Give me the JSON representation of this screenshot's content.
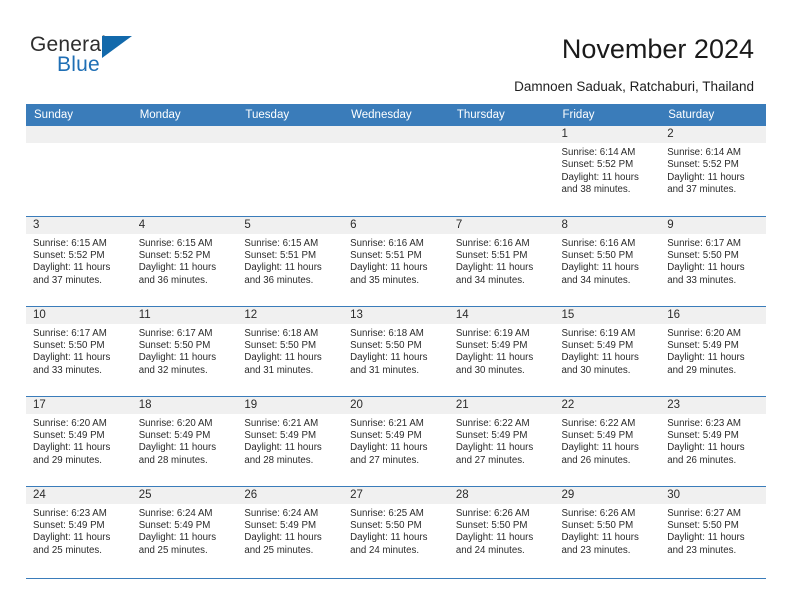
{
  "brand": {
    "name_part1": "General",
    "name_part2": "Blue",
    "triangle_color": "#1269ab",
    "blue_text_color": "#1f6fb5"
  },
  "header": {
    "title": "November 2024",
    "subtitle": "Damnoen Saduak, Ratchaburi, Thailand",
    "accent_color": "#3a7cba",
    "band_color": "#f0f0f0"
  },
  "weekday_headers": [
    "Sunday",
    "Monday",
    "Tuesday",
    "Wednesday",
    "Thursday",
    "Friday",
    "Saturday"
  ],
  "labels": {
    "sunrise": "Sunrise:",
    "sunset": "Sunset:",
    "daylight": "Daylight:"
  },
  "weeks": [
    [
      {
        "empty": true
      },
      {
        "empty": true
      },
      {
        "empty": true
      },
      {
        "empty": true
      },
      {
        "empty": true
      },
      {
        "day": "1",
        "sunrise": "Sunrise: 6:14 AM",
        "sunset": "Sunset: 5:52 PM",
        "daylight_l1": "Daylight: 11 hours",
        "daylight_l2": "and 38 minutes."
      },
      {
        "day": "2",
        "sunrise": "Sunrise: 6:14 AM",
        "sunset": "Sunset: 5:52 PM",
        "daylight_l1": "Daylight: 11 hours",
        "daylight_l2": "and 37 minutes."
      }
    ],
    [
      {
        "day": "3",
        "sunrise": "Sunrise: 6:15 AM",
        "sunset": "Sunset: 5:52 PM",
        "daylight_l1": "Daylight: 11 hours",
        "daylight_l2": "and 37 minutes."
      },
      {
        "day": "4",
        "sunrise": "Sunrise: 6:15 AM",
        "sunset": "Sunset: 5:52 PM",
        "daylight_l1": "Daylight: 11 hours",
        "daylight_l2": "and 36 minutes."
      },
      {
        "day": "5",
        "sunrise": "Sunrise: 6:15 AM",
        "sunset": "Sunset: 5:51 PM",
        "daylight_l1": "Daylight: 11 hours",
        "daylight_l2": "and 36 minutes."
      },
      {
        "day": "6",
        "sunrise": "Sunrise: 6:16 AM",
        "sunset": "Sunset: 5:51 PM",
        "daylight_l1": "Daylight: 11 hours",
        "daylight_l2": "and 35 minutes."
      },
      {
        "day": "7",
        "sunrise": "Sunrise: 6:16 AM",
        "sunset": "Sunset: 5:51 PM",
        "daylight_l1": "Daylight: 11 hours",
        "daylight_l2": "and 34 minutes."
      },
      {
        "day": "8",
        "sunrise": "Sunrise: 6:16 AM",
        "sunset": "Sunset: 5:50 PM",
        "daylight_l1": "Daylight: 11 hours",
        "daylight_l2": "and 34 minutes."
      },
      {
        "day": "9",
        "sunrise": "Sunrise: 6:17 AM",
        "sunset": "Sunset: 5:50 PM",
        "daylight_l1": "Daylight: 11 hours",
        "daylight_l2": "and 33 minutes."
      }
    ],
    [
      {
        "day": "10",
        "sunrise": "Sunrise: 6:17 AM",
        "sunset": "Sunset: 5:50 PM",
        "daylight_l1": "Daylight: 11 hours",
        "daylight_l2": "and 33 minutes."
      },
      {
        "day": "11",
        "sunrise": "Sunrise: 6:17 AM",
        "sunset": "Sunset: 5:50 PM",
        "daylight_l1": "Daylight: 11 hours",
        "daylight_l2": "and 32 minutes."
      },
      {
        "day": "12",
        "sunrise": "Sunrise: 6:18 AM",
        "sunset": "Sunset: 5:50 PM",
        "daylight_l1": "Daylight: 11 hours",
        "daylight_l2": "and 31 minutes."
      },
      {
        "day": "13",
        "sunrise": "Sunrise: 6:18 AM",
        "sunset": "Sunset: 5:50 PM",
        "daylight_l1": "Daylight: 11 hours",
        "daylight_l2": "and 31 minutes."
      },
      {
        "day": "14",
        "sunrise": "Sunrise: 6:19 AM",
        "sunset": "Sunset: 5:49 PM",
        "daylight_l1": "Daylight: 11 hours",
        "daylight_l2": "and 30 minutes."
      },
      {
        "day": "15",
        "sunrise": "Sunrise: 6:19 AM",
        "sunset": "Sunset: 5:49 PM",
        "daylight_l1": "Daylight: 11 hours",
        "daylight_l2": "and 30 minutes."
      },
      {
        "day": "16",
        "sunrise": "Sunrise: 6:20 AM",
        "sunset": "Sunset: 5:49 PM",
        "daylight_l1": "Daylight: 11 hours",
        "daylight_l2": "and 29 minutes."
      }
    ],
    [
      {
        "day": "17",
        "sunrise": "Sunrise: 6:20 AM",
        "sunset": "Sunset: 5:49 PM",
        "daylight_l1": "Daylight: 11 hours",
        "daylight_l2": "and 29 minutes."
      },
      {
        "day": "18",
        "sunrise": "Sunrise: 6:20 AM",
        "sunset": "Sunset: 5:49 PM",
        "daylight_l1": "Daylight: 11 hours",
        "daylight_l2": "and 28 minutes."
      },
      {
        "day": "19",
        "sunrise": "Sunrise: 6:21 AM",
        "sunset": "Sunset: 5:49 PM",
        "daylight_l1": "Daylight: 11 hours",
        "daylight_l2": "and 28 minutes."
      },
      {
        "day": "20",
        "sunrise": "Sunrise: 6:21 AM",
        "sunset": "Sunset: 5:49 PM",
        "daylight_l1": "Daylight: 11 hours",
        "daylight_l2": "and 27 minutes."
      },
      {
        "day": "21",
        "sunrise": "Sunrise: 6:22 AM",
        "sunset": "Sunset: 5:49 PM",
        "daylight_l1": "Daylight: 11 hours",
        "daylight_l2": "and 27 minutes."
      },
      {
        "day": "22",
        "sunrise": "Sunrise: 6:22 AM",
        "sunset": "Sunset: 5:49 PM",
        "daylight_l1": "Daylight: 11 hours",
        "daylight_l2": "and 26 minutes."
      },
      {
        "day": "23",
        "sunrise": "Sunrise: 6:23 AM",
        "sunset": "Sunset: 5:49 PM",
        "daylight_l1": "Daylight: 11 hours",
        "daylight_l2": "and 26 minutes."
      }
    ],
    [
      {
        "day": "24",
        "sunrise": "Sunrise: 6:23 AM",
        "sunset": "Sunset: 5:49 PM",
        "daylight_l1": "Daylight: 11 hours",
        "daylight_l2": "and 25 minutes."
      },
      {
        "day": "25",
        "sunrise": "Sunrise: 6:24 AM",
        "sunset": "Sunset: 5:49 PM",
        "daylight_l1": "Daylight: 11 hours",
        "daylight_l2": "and 25 minutes."
      },
      {
        "day": "26",
        "sunrise": "Sunrise: 6:24 AM",
        "sunset": "Sunset: 5:49 PM",
        "daylight_l1": "Daylight: 11 hours",
        "daylight_l2": "and 25 minutes."
      },
      {
        "day": "27",
        "sunrise": "Sunrise: 6:25 AM",
        "sunset": "Sunset: 5:50 PM",
        "daylight_l1": "Daylight: 11 hours",
        "daylight_l2": "and 24 minutes."
      },
      {
        "day": "28",
        "sunrise": "Sunrise: 6:26 AM",
        "sunset": "Sunset: 5:50 PM",
        "daylight_l1": "Daylight: 11 hours",
        "daylight_l2": "and 24 minutes."
      },
      {
        "day": "29",
        "sunrise": "Sunrise: 6:26 AM",
        "sunset": "Sunset: 5:50 PM",
        "daylight_l1": "Daylight: 11 hours",
        "daylight_l2": "and 23 minutes."
      },
      {
        "day": "30",
        "sunrise": "Sunrise: 6:27 AM",
        "sunset": "Sunset: 5:50 PM",
        "daylight_l1": "Daylight: 11 hours",
        "daylight_l2": "and 23 minutes."
      }
    ]
  ]
}
